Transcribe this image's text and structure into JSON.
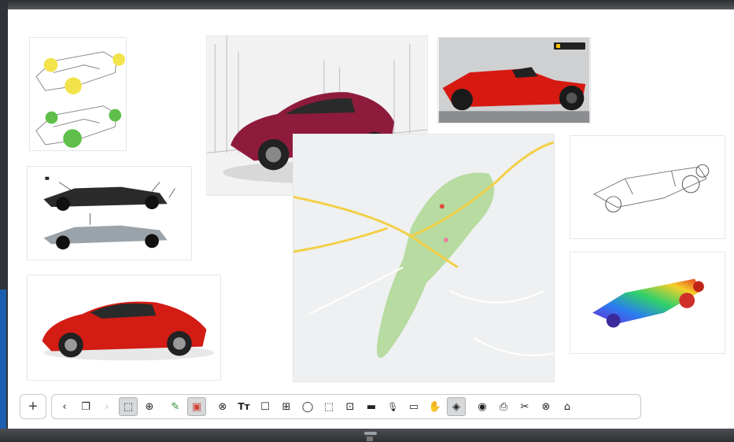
{
  "toolbar": {
    "add": "+",
    "buttons": [
      {
        "glyph": "‹",
        "icon": "back-icon"
      },
      {
        "glyph": "❐",
        "icon": "copy-icon"
      },
      {
        "glyph": "›",
        "icon": "forward-icon"
      },
      {
        "glyph": "⬚",
        "icon": "select-icon"
      },
      {
        "glyph": "⊕",
        "icon": "insert-icon"
      },
      {
        "glyph": "✎",
        "icon": "pen-icon"
      },
      {
        "glyph": "▣",
        "icon": "color-icon"
      },
      {
        "glyph": "⊗",
        "icon": "eraser-icon"
      },
      {
        "glyph": "Tт",
        "icon": "text-icon"
      },
      {
        "glyph": "☐",
        "icon": "page-icon"
      },
      {
        "glyph": "⊞",
        "icon": "image-icon"
      },
      {
        "glyph": "◯",
        "icon": "lasso-icon"
      },
      {
        "glyph": "⬚",
        "icon": "crop-icon"
      },
      {
        "glyph": "⊡",
        "icon": "screen-icon"
      },
      {
        "glyph": "▬",
        "icon": "video-icon"
      },
      {
        "glyph": "🎙",
        "icon": "microphone-icon"
      },
      {
        "glyph": "▭",
        "icon": "keyboard-icon"
      },
      {
        "glyph": "✋",
        "icon": "hand-icon"
      },
      {
        "glyph": "◈",
        "icon": "settings-icon"
      },
      {
        "glyph": "◉",
        "icon": "record-icon"
      },
      {
        "glyph": "⎙",
        "icon": "print-icon"
      },
      {
        "glyph": "✂",
        "icon": "scissors-icon"
      },
      {
        "glyph": "⊗",
        "icon": "close-icon"
      },
      {
        "glyph": "⌂",
        "icon": "home-icon"
      }
    ]
  }
}
